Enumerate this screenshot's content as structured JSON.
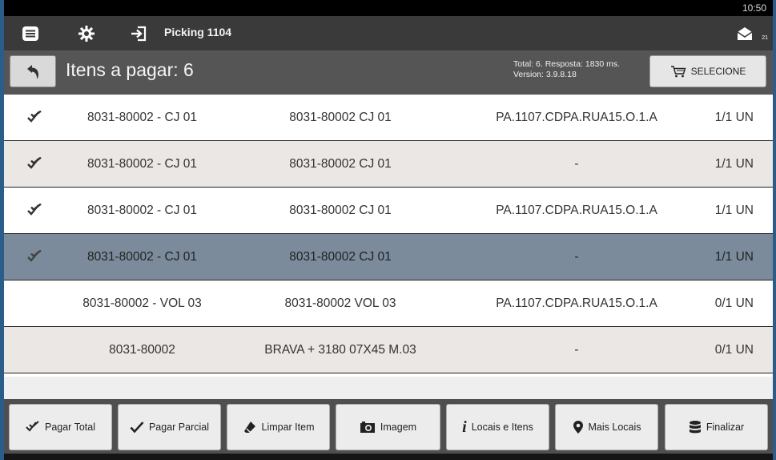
{
  "status": {
    "time": "10:50"
  },
  "topbar": {
    "title": "Picking 1104",
    "mail_count": "21",
    "icons": [
      "menu-icon",
      "gear-icon",
      "login-icon",
      "mail-icon"
    ]
  },
  "header": {
    "title": "Itens a pagar: 6",
    "info_line1": "Total: 6. Resposta: 1830 ms.",
    "info_line2": "Version: 3.9.8.18",
    "select_label": "SELECIONE"
  },
  "items": [
    {
      "checked": true,
      "code": "8031-80002 - CJ 01",
      "desc": "8031-80002 CJ 01",
      "loc": "PA.1107.CDPA.RUA15.O.1.A",
      "qty": "1/1 UN"
    },
    {
      "checked": true,
      "code": "8031-80002 - CJ 01",
      "desc": "8031-80002 CJ 01",
      "loc": "-",
      "qty": "1/1 UN"
    },
    {
      "checked": true,
      "code": "8031-80002 - CJ 01",
      "desc": "8031-80002 CJ 01",
      "loc": "PA.1107.CDPA.RUA15.O.1.A",
      "qty": "1/1 UN"
    },
    {
      "checked": true,
      "code": "8031-80002 - CJ 01",
      "desc": "8031-80002 CJ 01",
      "loc": "-",
      "qty": "1/1 UN"
    },
    {
      "checked": false,
      "code": "8031-80002 - VOL 03",
      "desc": "8031-80002 VOL 03",
      "loc": "PA.1107.CDPA.RUA15.O.1.A",
      "qty": "0/1 UN"
    },
    {
      "checked": false,
      "code": "8031-80002",
      "desc": "BRAVA + 3180 07X45 M.03",
      "loc": "-",
      "qty": "0/1 UN"
    }
  ],
  "selected_row": 3,
  "footer": {
    "pagar_total": "Pagar Total",
    "pagar_parcial": "Pagar Parcial",
    "limpar_item": "Limpar Item",
    "imagem": "Imagem",
    "locais_itens": "Locais e Itens",
    "mais_locais": "Mais Locais",
    "finalizar": "Finalizar"
  },
  "colors": {
    "topbar": "#3a3a3a",
    "header": "#555555",
    "row_alt": "#ebe7e5",
    "row_selected": "#7b8b9b"
  }
}
